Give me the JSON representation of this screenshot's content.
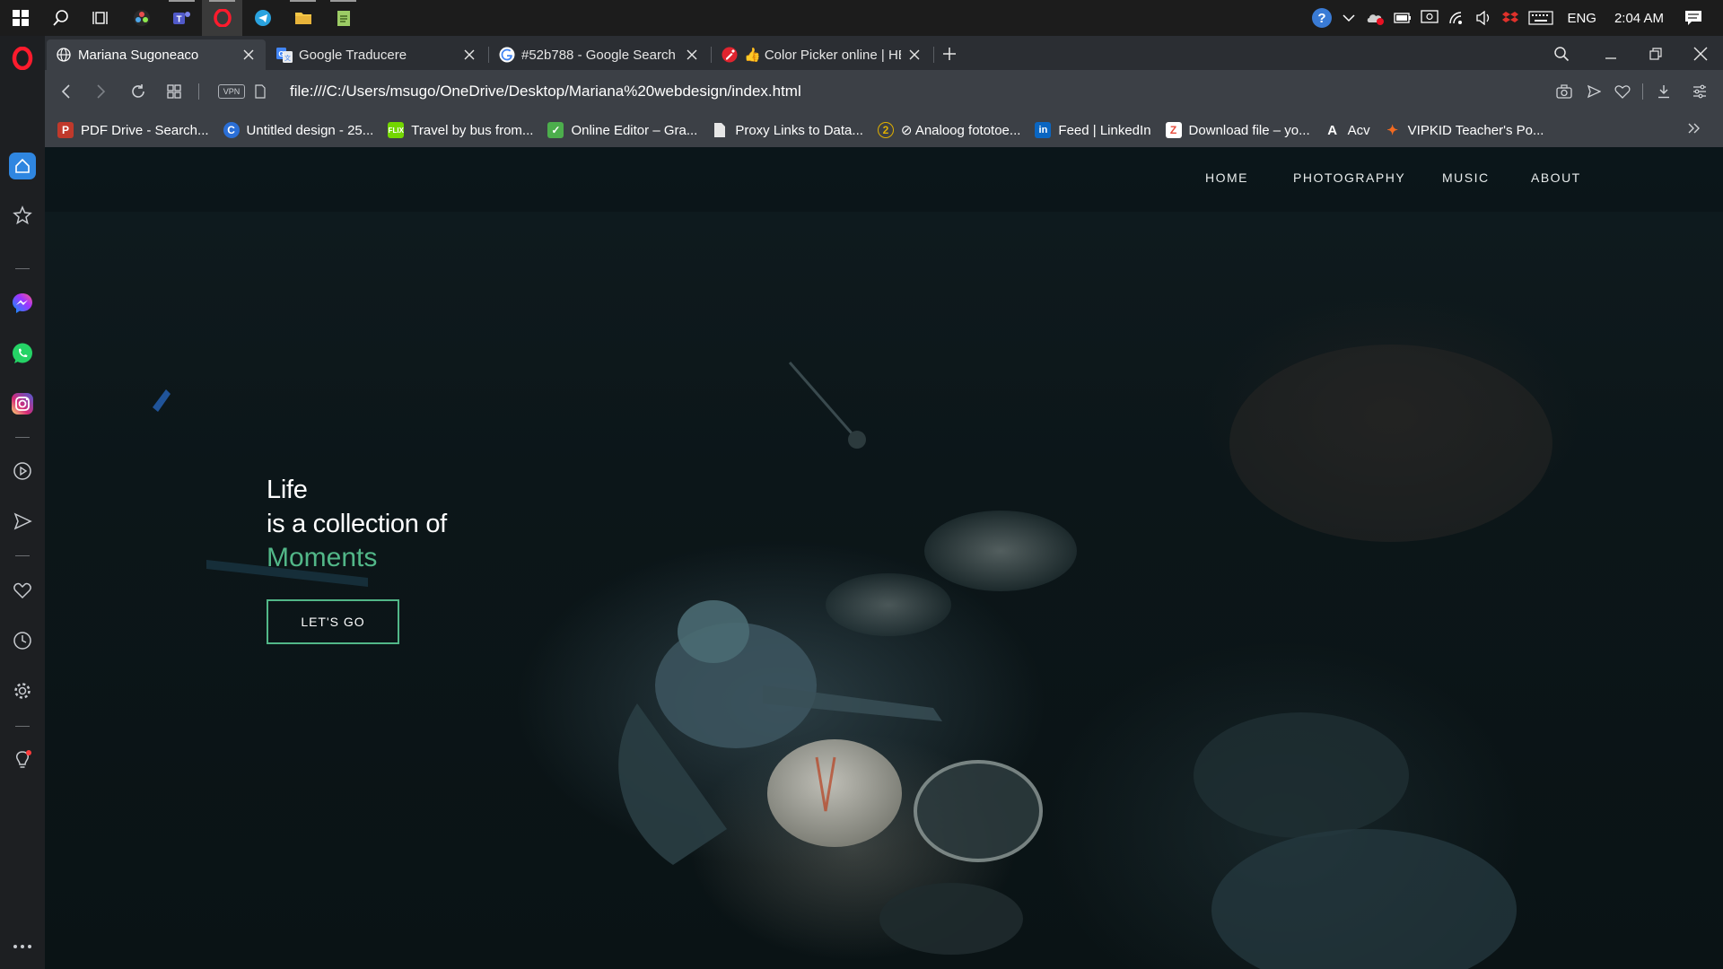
{
  "taskbar": {
    "language": "ENG",
    "time": "2:04 AM",
    "pinned_icons": [
      "windows-start-icon",
      "search-icon",
      "task-view-icon",
      "davinci-resolve-icon",
      "teams-icon",
      "opera-icon",
      "telegram-icon",
      "file-explorer-icon",
      "notepad-icon"
    ],
    "tray_icons": [
      "help-icon",
      "chevron-up-icon",
      "onedrive-error-icon",
      "battery-icon",
      "screen-icon",
      "wifi-icon",
      "volume-icon",
      "dropbox-icon",
      "keyboard-icon",
      "notifications-icon"
    ]
  },
  "sidebar": {
    "icons": [
      "opera-logo-icon",
      "home-icon",
      "star-icon",
      "messenger-icon",
      "whatsapp-icon",
      "instagram-icon",
      "player-icon",
      "send-icon",
      "heart-icon",
      "history-icon",
      "settings-icon",
      "lightbulb-icon",
      "more-icon"
    ]
  },
  "tabs": [
    {
      "title": "Mariana Sugoneaco",
      "favicon": "globe-icon",
      "active": true
    },
    {
      "title": "Google Traducere",
      "favicon": "google-translate-icon",
      "active": false
    },
    {
      "title": "#52b788 - Google Search",
      "favicon": "google-icon",
      "active": false
    },
    {
      "title": "👍 Color Picker online | HE",
      "favicon": "color-picker-icon",
      "active": false
    }
  ],
  "address_bar": {
    "vpn_label": "VPN",
    "url": "file:///C:/Users/msugo/OneDrive/Desktop/Mariana%20webdesign/index.html"
  },
  "bookmarks": [
    {
      "label": "PDF Drive - Search...",
      "icon": "pdf-drive-icon",
      "color": "#c0392b",
      "glyph": "P"
    },
    {
      "label": "Untitled design - 25...",
      "icon": "canva-icon",
      "color": "#2b6fd6",
      "glyph": "C"
    },
    {
      "label": "Travel by bus from...",
      "icon": "flixbus-icon",
      "color": "#73d700",
      "glyph": "F"
    },
    {
      "label": "Online Editor – Gra...",
      "icon": "grammarly-check-icon",
      "color": "#4cae4c",
      "glyph": "✓"
    },
    {
      "label": "Proxy Links to Data...",
      "icon": "document-icon",
      "color": "#e6e6e6",
      "glyph": "▯"
    },
    {
      "label": "⊘ Analoog fototoe...",
      "icon": "analog-icon",
      "color": "#e0b000",
      "glyph": "2"
    },
    {
      "label": "Feed | LinkedIn",
      "icon": "linkedin-icon",
      "color": "#0a66c2",
      "glyph": "in"
    },
    {
      "label": "Download file – yo...",
      "icon": "download-file-icon",
      "color": "#e74c3c",
      "glyph": "Z"
    },
    {
      "label": "Acv",
      "icon": "acv-icon",
      "color": "#3c4046",
      "glyph": "A"
    },
    {
      "label": "VIPKID Teacher's Po...",
      "icon": "vipkid-icon",
      "color": "#f26a21",
      "glyph": "✦"
    }
  ],
  "site": {
    "nav": [
      "HOME",
      "PHOTOGRAPHY",
      "MUSIC",
      "ABOUT"
    ],
    "hero_line1": "Life",
    "hero_line2": "is a collection of",
    "hero_accent": "Moments",
    "cta_label": "LET'S GO",
    "accent_color": "#52b788"
  }
}
